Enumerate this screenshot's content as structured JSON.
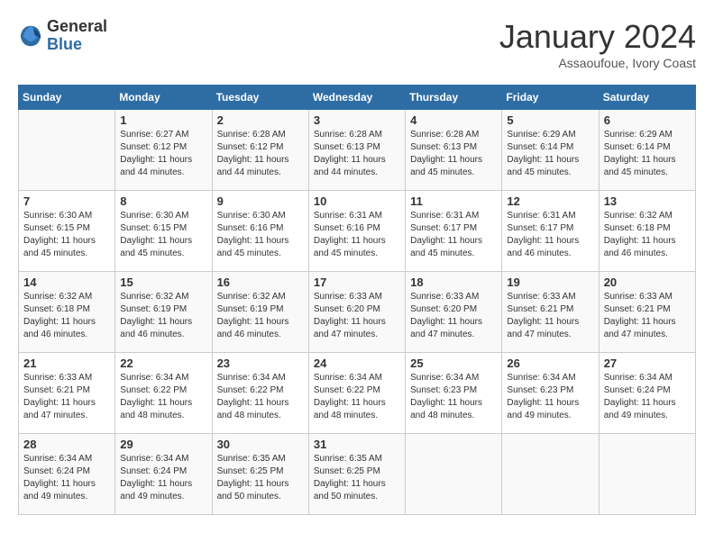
{
  "header": {
    "logo_general": "General",
    "logo_blue": "Blue",
    "month": "January 2024",
    "location": "Assaoufoue, Ivory Coast"
  },
  "days_of_week": [
    "Sunday",
    "Monday",
    "Tuesday",
    "Wednesday",
    "Thursday",
    "Friday",
    "Saturday"
  ],
  "weeks": [
    [
      {
        "day": "",
        "info": ""
      },
      {
        "day": "1",
        "info": "Sunrise: 6:27 AM\nSunset: 6:12 PM\nDaylight: 11 hours and 44 minutes."
      },
      {
        "day": "2",
        "info": "Sunrise: 6:28 AM\nSunset: 6:12 PM\nDaylight: 11 hours and 44 minutes."
      },
      {
        "day": "3",
        "info": "Sunrise: 6:28 AM\nSunset: 6:13 PM\nDaylight: 11 hours and 44 minutes."
      },
      {
        "day": "4",
        "info": "Sunrise: 6:28 AM\nSunset: 6:13 PM\nDaylight: 11 hours and 45 minutes."
      },
      {
        "day": "5",
        "info": "Sunrise: 6:29 AM\nSunset: 6:14 PM\nDaylight: 11 hours and 45 minutes."
      },
      {
        "day": "6",
        "info": "Sunrise: 6:29 AM\nSunset: 6:14 PM\nDaylight: 11 hours and 45 minutes."
      }
    ],
    [
      {
        "day": "7",
        "info": "Sunrise: 6:30 AM\nSunset: 6:15 PM\nDaylight: 11 hours and 45 minutes."
      },
      {
        "day": "8",
        "info": "Sunrise: 6:30 AM\nSunset: 6:15 PM\nDaylight: 11 hours and 45 minutes."
      },
      {
        "day": "9",
        "info": "Sunrise: 6:30 AM\nSunset: 6:16 PM\nDaylight: 11 hours and 45 minutes."
      },
      {
        "day": "10",
        "info": "Sunrise: 6:31 AM\nSunset: 6:16 PM\nDaylight: 11 hours and 45 minutes."
      },
      {
        "day": "11",
        "info": "Sunrise: 6:31 AM\nSunset: 6:17 PM\nDaylight: 11 hours and 45 minutes."
      },
      {
        "day": "12",
        "info": "Sunrise: 6:31 AM\nSunset: 6:17 PM\nDaylight: 11 hours and 46 minutes."
      },
      {
        "day": "13",
        "info": "Sunrise: 6:32 AM\nSunset: 6:18 PM\nDaylight: 11 hours and 46 minutes."
      }
    ],
    [
      {
        "day": "14",
        "info": "Sunrise: 6:32 AM\nSunset: 6:18 PM\nDaylight: 11 hours and 46 minutes."
      },
      {
        "day": "15",
        "info": "Sunrise: 6:32 AM\nSunset: 6:19 PM\nDaylight: 11 hours and 46 minutes."
      },
      {
        "day": "16",
        "info": "Sunrise: 6:32 AM\nSunset: 6:19 PM\nDaylight: 11 hours and 46 minutes."
      },
      {
        "day": "17",
        "info": "Sunrise: 6:33 AM\nSunset: 6:20 PM\nDaylight: 11 hours and 47 minutes."
      },
      {
        "day": "18",
        "info": "Sunrise: 6:33 AM\nSunset: 6:20 PM\nDaylight: 11 hours and 47 minutes."
      },
      {
        "day": "19",
        "info": "Sunrise: 6:33 AM\nSunset: 6:21 PM\nDaylight: 11 hours and 47 minutes."
      },
      {
        "day": "20",
        "info": "Sunrise: 6:33 AM\nSunset: 6:21 PM\nDaylight: 11 hours and 47 minutes."
      }
    ],
    [
      {
        "day": "21",
        "info": "Sunrise: 6:33 AM\nSunset: 6:21 PM\nDaylight: 11 hours and 47 minutes."
      },
      {
        "day": "22",
        "info": "Sunrise: 6:34 AM\nSunset: 6:22 PM\nDaylight: 11 hours and 48 minutes."
      },
      {
        "day": "23",
        "info": "Sunrise: 6:34 AM\nSunset: 6:22 PM\nDaylight: 11 hours and 48 minutes."
      },
      {
        "day": "24",
        "info": "Sunrise: 6:34 AM\nSunset: 6:22 PM\nDaylight: 11 hours and 48 minutes."
      },
      {
        "day": "25",
        "info": "Sunrise: 6:34 AM\nSunset: 6:23 PM\nDaylight: 11 hours and 48 minutes."
      },
      {
        "day": "26",
        "info": "Sunrise: 6:34 AM\nSunset: 6:23 PM\nDaylight: 11 hours and 49 minutes."
      },
      {
        "day": "27",
        "info": "Sunrise: 6:34 AM\nSunset: 6:24 PM\nDaylight: 11 hours and 49 minutes."
      }
    ],
    [
      {
        "day": "28",
        "info": "Sunrise: 6:34 AM\nSunset: 6:24 PM\nDaylight: 11 hours and 49 minutes."
      },
      {
        "day": "29",
        "info": "Sunrise: 6:34 AM\nSunset: 6:24 PM\nDaylight: 11 hours and 49 minutes."
      },
      {
        "day": "30",
        "info": "Sunrise: 6:35 AM\nSunset: 6:25 PM\nDaylight: 11 hours and 50 minutes."
      },
      {
        "day": "31",
        "info": "Sunrise: 6:35 AM\nSunset: 6:25 PM\nDaylight: 11 hours and 50 minutes."
      },
      {
        "day": "",
        "info": ""
      },
      {
        "day": "",
        "info": ""
      },
      {
        "day": "",
        "info": ""
      }
    ]
  ]
}
